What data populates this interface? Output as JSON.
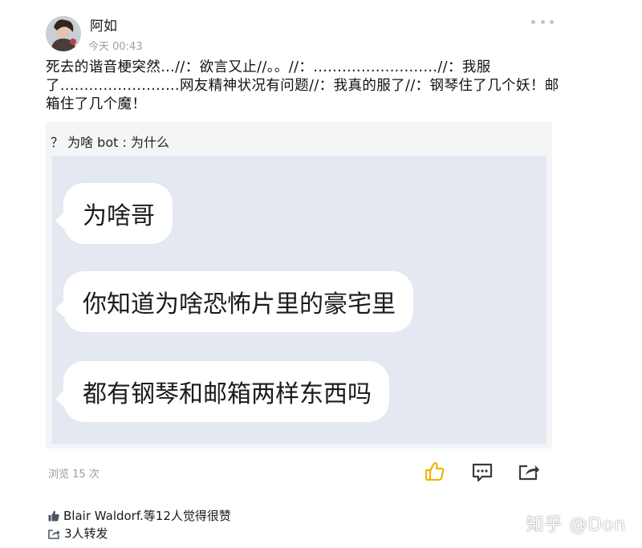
{
  "post": {
    "author": "阿如",
    "time": "今天 00:43",
    "text": "死去的谐音梗突然...//：欲言又止//。。//：..........................//：我服了.........................网友精神状况有问题//：我真的服了//：钢琴住了几个妖！邮箱住了几个魔！"
  },
  "quote": {
    "header": "？ 为啥 bot : 为什么",
    "messages": [
      "为啥哥",
      "你知道为啥恐怖片里的豪宅里",
      "都有钢琴和邮箱两样东西吗"
    ]
  },
  "stats": {
    "views": "浏览 15 次"
  },
  "footer": {
    "likes": "Blair Waldorf.等12人觉得很赞",
    "reposts": "3人转发"
  },
  "watermark": "知乎 @Don",
  "colors": {
    "like_accent": "#f2b400",
    "bubble_bg": "#ffffff",
    "chat_bg": "#e4e8f1"
  }
}
